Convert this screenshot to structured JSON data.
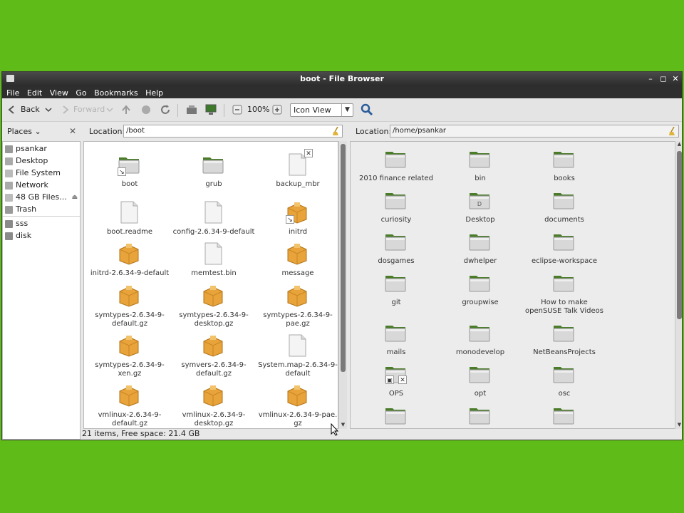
{
  "window": {
    "title": "boot - File Browser",
    "controls": [
      "minimize-icon",
      "maximize-icon",
      "close-icon"
    ]
  },
  "menu": [
    "File",
    "Edit",
    "View",
    "Go",
    "Bookmarks",
    "Help"
  ],
  "toolbar": {
    "back_label": "Back",
    "forward_label": "Forward",
    "zoom_level": "100%",
    "view_mode": "Icon View"
  },
  "places": {
    "title": "Places",
    "items": [
      {
        "label": "psankar",
        "icon": "home-icon"
      },
      {
        "label": "Desktop",
        "icon": "desktop-icon"
      },
      {
        "label": "File System",
        "icon": "drive-icon"
      },
      {
        "label": "Network",
        "icon": "network-icon"
      },
      {
        "label": "48 GB Files...",
        "icon": "drive-icon"
      },
      {
        "label": "Trash",
        "icon": "trash-icon"
      }
    ],
    "bookmarks": [
      {
        "label": "sss",
        "icon": "folder-icon"
      },
      {
        "label": "disk",
        "icon": "folder-icon"
      }
    ]
  },
  "left_pane": {
    "location_label": "Location:",
    "location": "/boot",
    "items": [
      {
        "name": "boot",
        "type": "folder",
        "badge": "link"
      },
      {
        "name": "grub",
        "type": "folder"
      },
      {
        "name": "backup_mbr",
        "type": "file",
        "badge": "x"
      },
      {
        "name": "boot.readme",
        "type": "file"
      },
      {
        "name": "config-2.6.34-9-default",
        "type": "file"
      },
      {
        "name": "initrd",
        "type": "package",
        "badge": "link"
      },
      {
        "name": "initrd-2.6.34-9-default",
        "type": "package"
      },
      {
        "name": "memtest.bin",
        "type": "file"
      },
      {
        "name": "message",
        "type": "package"
      },
      {
        "name": "symtypes-2.6.34-9-default.gz",
        "type": "package",
        "lines": [
          "symtypes-2.6.34-9-",
          "default.gz"
        ]
      },
      {
        "name": "symtypes-2.6.34-9-desktop.gz",
        "type": "package",
        "lines": [
          "symtypes-2.6.34-9-",
          "desktop.gz"
        ]
      },
      {
        "name": "symtypes-2.6.34-9-pae.gz",
        "type": "package",
        "lines": [
          "symtypes-2.6.34-9-",
          "pae.gz"
        ]
      },
      {
        "name": "symtypes-2.6.34-9-xen.gz",
        "type": "package",
        "lines": [
          "symtypes-2.6.34-9-",
          "xen.gz"
        ]
      },
      {
        "name": "symvers-2.6.34-9-default.gz",
        "type": "package",
        "lines": [
          "symvers-2.6.34-9-",
          "default.gz"
        ]
      },
      {
        "name": "System.map-2.6.34-9-default",
        "type": "file",
        "lines": [
          "System.map-2.6.34-9-",
          "default"
        ]
      },
      {
        "name": "vmlinux-2.6.34-9-default.gz",
        "type": "package",
        "lines": [
          "vmlinux-2.6.34-9-",
          "default.gz"
        ]
      },
      {
        "name": "vmlinux-2.6.34-9-desktop.gz",
        "type": "package",
        "lines": [
          "vmlinux-2.6.34-9-",
          "desktop.gz"
        ]
      },
      {
        "name": "vmlinux-2.6.34-9-pae.gz",
        "type": "package",
        "lines": [
          "vmlinux-2.6.34-9-pae.",
          "gz"
        ]
      }
    ],
    "status": "21 items, Free space: 21.4 GB"
  },
  "right_pane": {
    "location_label": "Location:",
    "location": "/home/psankar",
    "items": [
      {
        "name": "2010 finance related",
        "type": "folder"
      },
      {
        "name": "bin",
        "type": "folder"
      },
      {
        "name": "books",
        "type": "folder"
      },
      {
        "name": "curiosity",
        "type": "folder"
      },
      {
        "name": "Desktop",
        "type": "desktop-folder"
      },
      {
        "name": "documents",
        "type": "folder"
      },
      {
        "name": "dosgames",
        "type": "folder"
      },
      {
        "name": "dwhelper",
        "type": "folder"
      },
      {
        "name": "eclipse-workspace",
        "type": "folder"
      },
      {
        "name": "git",
        "type": "folder"
      },
      {
        "name": "groupwise",
        "type": "folder"
      },
      {
        "name": "How to make openSUSE Talk Videos",
        "type": "folder",
        "lines": [
          "How to make",
          "openSUSE Talk Videos"
        ]
      },
      {
        "name": "mails",
        "type": "folder"
      },
      {
        "name": "monodevelop",
        "type": "folder"
      },
      {
        "name": "NetBeansProjects",
        "type": "folder"
      },
      {
        "name": "OPS",
        "type": "folder",
        "badge": "lock-x"
      },
      {
        "name": "opt",
        "type": "folder"
      },
      {
        "name": "osc",
        "type": "folder"
      },
      {
        "name": "",
        "type": "folder"
      },
      {
        "name": "",
        "type": "folder"
      },
      {
        "name": "",
        "type": "folder"
      }
    ]
  },
  "colors": {
    "desktop_bg": "#5fbb18",
    "titlebar": "#2e2e2e",
    "folder_tab": "#4a7c2a",
    "package": "#e8a33a"
  }
}
